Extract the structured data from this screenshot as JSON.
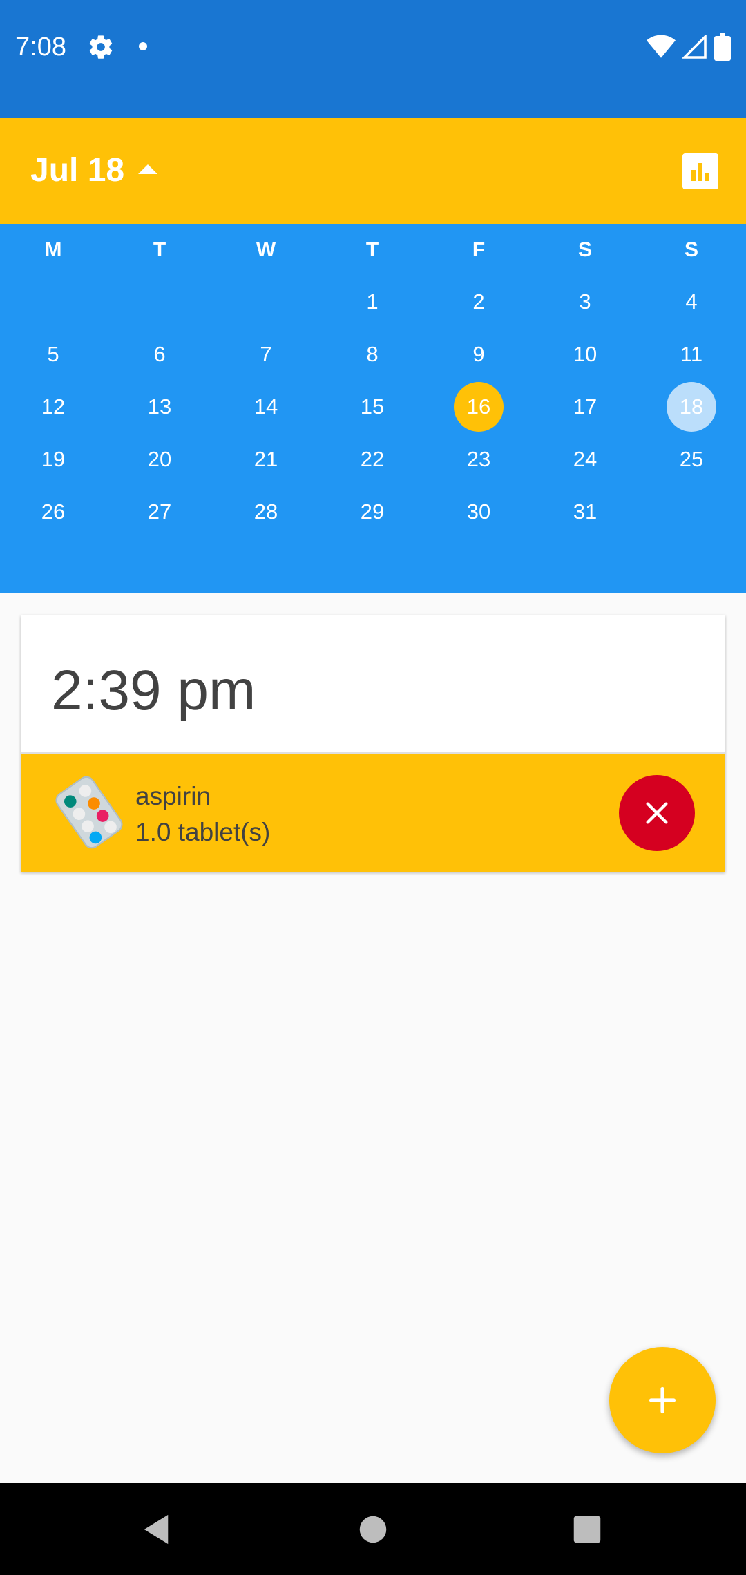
{
  "status_bar": {
    "time": "7:08",
    "icons": [
      "settings-icon",
      "notification-dot-icon",
      "wifi-icon",
      "signal-icon",
      "battery-icon"
    ]
  },
  "app_bar": {
    "month_label": "Jul 18",
    "stats_icon": "bar-chart-icon",
    "color": "#FFC107"
  },
  "calendar": {
    "weekdays": [
      "M",
      "T",
      "W",
      "T",
      "F",
      "S",
      "S"
    ],
    "weeks": [
      [
        "",
        "",
        "",
        "1",
        "2",
        "3",
        "4"
      ],
      [
        "5",
        "6",
        "7",
        "8",
        "9",
        "10",
        "11"
      ],
      [
        "12",
        "13",
        "14",
        "15",
        "16",
        "17",
        "18"
      ],
      [
        "19",
        "20",
        "21",
        "22",
        "23",
        "24",
        "25"
      ],
      [
        "26",
        "27",
        "28",
        "29",
        "30",
        "31",
        ""
      ]
    ],
    "today": "16",
    "selected": "18",
    "color": "#2196F3"
  },
  "schedule": {
    "time_header": "2:39 pm",
    "medications": [
      {
        "name": "aspirin",
        "dose": "1.0 tablet(s)",
        "icon": "pill-blister-icon",
        "remove_icon": "close-icon"
      }
    ]
  },
  "fab": {
    "icon": "plus-icon"
  },
  "nav_bar": {
    "buttons": [
      "back-icon",
      "home-icon",
      "recents-icon"
    ]
  }
}
